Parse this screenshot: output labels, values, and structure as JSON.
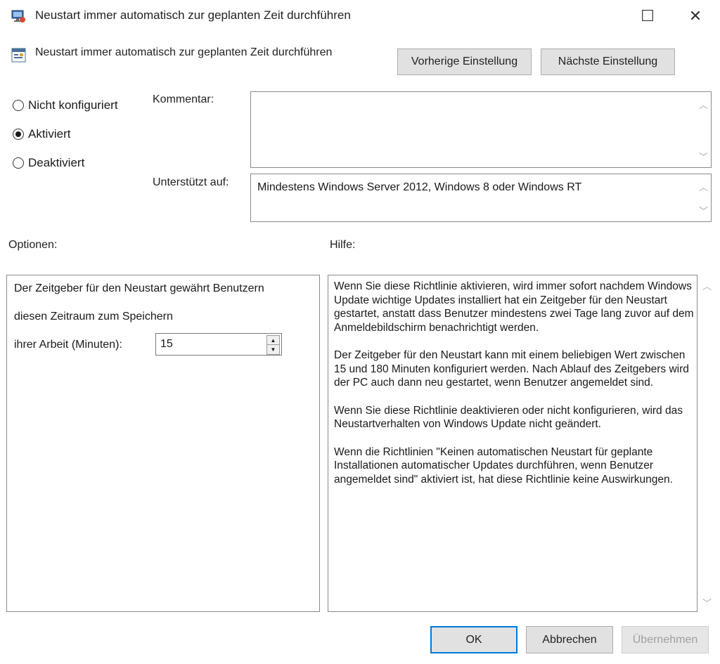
{
  "window": {
    "title": "Neustart immer automatisch zur geplanten Zeit durchführen",
    "maximize_glyph": "☐",
    "close_glyph": "✕",
    "app_icon": "policy-window-icon"
  },
  "header": {
    "setting_name": "Neustart immer automatisch zur geplanten Zeit durchführen",
    "setting_icon": "policy-setting-icon",
    "prev_button": "Vorherige Einstellung",
    "next_button": "Nächste Einstellung"
  },
  "state": {
    "options": [
      {
        "label": "Nicht konfiguriert",
        "checked": false
      },
      {
        "label": "Aktiviert",
        "checked": true
      },
      {
        "label": "Deaktiviert",
        "checked": false
      }
    ]
  },
  "comment": {
    "label": "Kommentar:",
    "value": ""
  },
  "supported": {
    "label": "Unterstützt auf:",
    "value": "Mindestens Windows Server 2012, Windows 8 oder Windows RT"
  },
  "options_section": {
    "label": "Optionen:",
    "line1": "Der Zeitgeber für den  Neustart gewährt Benutzern",
    "line2": "diesen Zeitraum zum Speichern",
    "line3": "ihrer Arbeit (Minuten):",
    "spin_value": "15"
  },
  "help_section": {
    "label": "Hilfe:",
    "paragraphs": [
      "Wenn Sie diese Richtlinie aktivieren, wird immer sofort nachdem Windows Update wichtige Updates installiert hat ein Zeitgeber für den Neustart gestartet, anstatt dass Benutzer mindestens zwei Tage lang zuvor auf dem Anmeldebildschirm benachrichtigt werden.",
      "Der Zeitgeber für den Neustart kann mit einem beliebigen Wert zwischen 15 und 180 Minuten konfiguriert werden. Nach Ablauf des Zeitgebers wird der PC auch dann neu gestartet, wenn Benutzer angemeldet sind.",
      "Wenn Sie diese Richtlinie deaktivieren oder nicht konfigurieren, wird das Neustartverhalten von Windows Update nicht geändert.",
      "Wenn die Richtlinien \"Keinen automatischen Neustart für geplante Installationen automatischer Updates durchführen, wenn Benutzer angemeldet sind\" aktiviert ist, hat diese Richtlinie keine Auswirkungen."
    ]
  },
  "footer": {
    "ok": "OK",
    "cancel": "Abbrechen",
    "apply": "Übernehmen"
  }
}
